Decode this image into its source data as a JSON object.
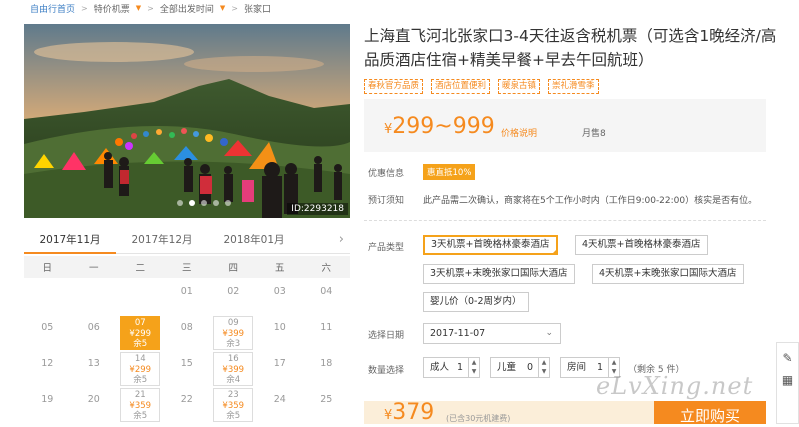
{
  "breadcrumb": {
    "home": "自由行首页",
    "category": "特价机票",
    "time": "全部出发时间",
    "dest": "张家口"
  },
  "hero": {
    "image_id": "ID:2293218",
    "slide_count": 5,
    "active_slide": 2
  },
  "calendar": {
    "months": [
      "2017年11月",
      "2017年12月",
      "2018年01月"
    ],
    "active_month": 0,
    "weekdays": [
      "日",
      "一",
      "二",
      "三",
      "四",
      "五",
      "六"
    ],
    "rows": [
      [
        {
          "d": ""
        },
        {
          "d": ""
        },
        {
          "d": ""
        },
        {
          "d": "01"
        },
        {
          "d": "02"
        },
        {
          "d": "03"
        },
        {
          "d": "04"
        }
      ],
      [
        {
          "d": "05"
        },
        {
          "d": "06"
        },
        {
          "d": "07",
          "p": "¥299",
          "r": "余5",
          "sel": true
        },
        {
          "d": "08"
        },
        {
          "d": "09",
          "p": "¥399",
          "r": "余3"
        },
        {
          "d": "10"
        },
        {
          "d": "11"
        }
      ],
      [
        {
          "d": "12"
        },
        {
          "d": "13"
        },
        {
          "d": "14",
          "p": "¥299",
          "r": "余5"
        },
        {
          "d": "15"
        },
        {
          "d": "16",
          "p": "¥399",
          "r": "余4"
        },
        {
          "d": "17"
        },
        {
          "d": "18"
        }
      ],
      [
        {
          "d": "19"
        },
        {
          "d": "20"
        },
        {
          "d": "21",
          "p": "¥359",
          "r": "余5"
        },
        {
          "d": "22"
        },
        {
          "d": "23",
          "p": "¥359",
          "r": "余5"
        },
        {
          "d": "24"
        },
        {
          "d": "25"
        }
      ]
    ]
  },
  "product": {
    "title": "上海直飞河北张家口3-4天往返含税机票（可选含1晚经济/高品质酒店住宿+精美早餐+早去午回航班）",
    "tags": [
      "春秋官方品质",
      "酒店位置便利",
      "暖泉古镇",
      "崇礼滑雪季"
    ],
    "price_currency": "¥",
    "price_range": "299~999",
    "price_explain": "价格说明",
    "sold": "月售8",
    "promo_label": "优惠信息",
    "promo_badge": "惠直抵10%",
    "notice_label": "预订须知",
    "notice_text": "此产品需二次确认，商家将在5个工作小时内（工作日9:00-22:00）核实是否有位。",
    "type_label": "产品类型",
    "types": [
      "3天机票+首晚格林豪泰酒店",
      "4天机票+首晚格林豪泰酒店",
      "3天机票+末晚张家口国际大酒店",
      "4天机票+末晚张家口国际大酒店",
      "婴儿价（0-2周岁内）"
    ],
    "active_type": 0,
    "date_label": "选择日期",
    "date_value": "2017-11-07",
    "qty_label": "数量选择",
    "adult_label": "成人",
    "adult_value": "1",
    "child_label": "儿童",
    "child_value": "0",
    "room_label": "房间",
    "room_value": "1",
    "remain": "（剩余 5 件）",
    "total_currency": "¥",
    "total": "379",
    "total_note": "(已含30元机建费)",
    "buy_label": "立即购买"
  },
  "watermark": "eLvXing.net",
  "icons": {
    "edit": "pencil-icon",
    "qr": "qrcode-icon",
    "next": "chevron-right-icon"
  }
}
